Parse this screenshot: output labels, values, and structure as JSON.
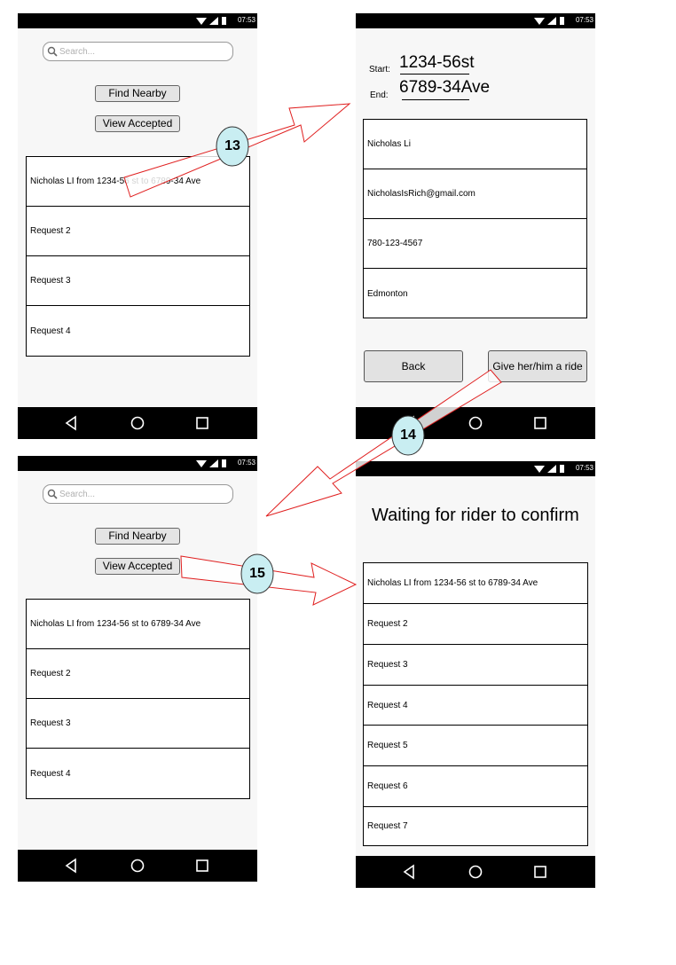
{
  "status_time": "07:53",
  "screen1": {
    "search_placeholder": "Search...",
    "find_nearby": "Find Nearby",
    "view_accepted": "View Accepted",
    "rows": [
      "Nicholas LI from 1234-56 st to 6789-34 Ave",
      "Request 2",
      "Request 3",
      "Request 4"
    ]
  },
  "screen2": {
    "start_label": "Start:",
    "start_value": "1234-56st",
    "end_label": "End:",
    "end_value": "6789-34Ave",
    "rows": [
      "Nicholas Li",
      "NicholasIsRich@gmail.com",
      "780-123-4567",
      "Edmonton"
    ],
    "back": "Back",
    "give_ride": "Give her/him a ride"
  },
  "screen3": {
    "search_placeholder": "Search...",
    "find_nearby": "Find Nearby",
    "view_accepted": "View Accepted",
    "rows": [
      "Nicholas LI from 1234-56 st to 6789-34 Ave",
      "Request 2",
      "Request 3",
      "Request 4"
    ]
  },
  "screen4": {
    "title": "Waiting for rider to confirm",
    "rows": [
      "Nicholas LI from 1234-56 st to 6789-34 Ave",
      "Request 2",
      "Request 3",
      "Request 4",
      "Request 5",
      "Request 6",
      "Request 7"
    ]
  },
  "badges": [
    "13",
    "14",
    "15"
  ],
  "colors": {
    "arrow_stroke": "#e02020",
    "badge_fill": "#c9eef2"
  }
}
